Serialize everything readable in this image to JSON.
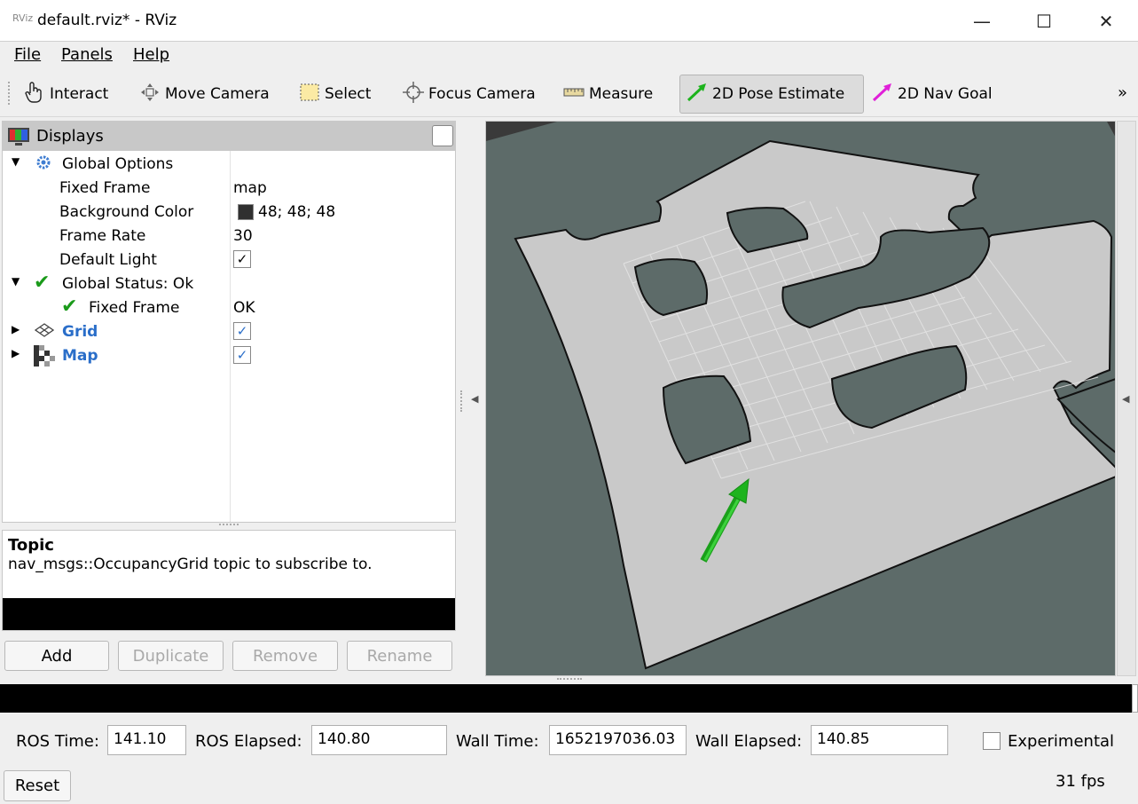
{
  "window": {
    "title": "default.rviz* - RViz",
    "app_icon_text": "RViz",
    "controls": [
      "minimize",
      "maximize",
      "close"
    ]
  },
  "menu": [
    "File",
    "Panels",
    "Help"
  ],
  "toolbar": {
    "tools": [
      {
        "label": "Interact",
        "icon": "hand-pointer-icon"
      },
      {
        "label": "Move Camera",
        "icon": "move-camera-icon"
      },
      {
        "label": "Select",
        "icon": "select-box-icon"
      },
      {
        "label": "Focus Camera",
        "icon": "crosshair-icon"
      },
      {
        "label": "Measure",
        "icon": "ruler-icon"
      },
      {
        "label": "2D Pose Estimate",
        "icon": "green-arrow-icon",
        "active": true
      },
      {
        "label": "2D Nav Goal",
        "icon": "magenta-arrow-icon"
      }
    ],
    "overflow": "»"
  },
  "displays": {
    "title": "Displays",
    "tree": {
      "global_options": "Global Options",
      "fixed_frame_label": "Fixed Frame",
      "fixed_frame_value": "map",
      "background_color_label": "Background Color",
      "background_color_value": "48; 48; 48",
      "background_swatch": "#303030",
      "frame_rate_label": "Frame Rate",
      "frame_rate_value": "30",
      "default_light_label": "Default Light",
      "global_status": "Global Status: Ok",
      "status_fixed_frame": "Fixed Frame",
      "status_fixed_frame_value": "OK",
      "grid": "Grid",
      "map": "Map"
    }
  },
  "topic": {
    "title": "Topic",
    "description": "nav_msgs::OccupancyGrid topic to subscribe to."
  },
  "buttons": {
    "add": "Add",
    "duplicate": "Duplicate",
    "remove": "Remove",
    "rename": "Rename",
    "reset": "Reset"
  },
  "time": {
    "ros_time_label": "ROS Time:",
    "ros_time": "141.10",
    "ros_elapsed_label": "ROS Elapsed:",
    "ros_elapsed": "140.80",
    "wall_time_label": "Wall Time:",
    "wall_time": "1652197036.03",
    "wall_elapsed_label": "Wall Elapsed:",
    "wall_elapsed": "140.85",
    "experimental": "Experimental",
    "fps": "31 fps"
  },
  "colors": {
    "viewport_bg": "#5d6b69",
    "map_free": "#c8c8c8",
    "obstacle": "#5d6b69",
    "pose_arrow": "#1db31d",
    "link_blue": "#2a6ec9"
  }
}
